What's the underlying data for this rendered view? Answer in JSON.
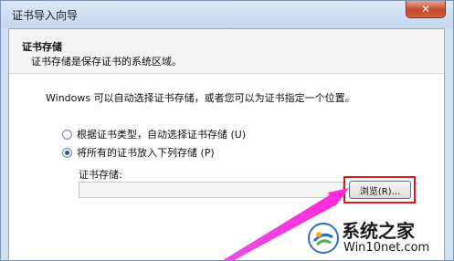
{
  "window": {
    "title": "证书导入向导",
    "close_glyph": "✕"
  },
  "header": {
    "title": "证书存储",
    "subtitle": "证书存储是保存证书的系统区域。"
  },
  "main": {
    "description": "Windows 可以自动选择证书存储，或者您可以为证书指定一个位置。",
    "options": [
      {
        "label": "根据证书类型，自动选择证书存储 (U)",
        "checked": false
      },
      {
        "label": "将所有的证书放入下列存储 (P)",
        "checked": true
      }
    ],
    "store_label": "证书存储:",
    "store_value": "",
    "browse_label": "浏览(R)..."
  },
  "watermark": {
    "brand": "系统之家",
    "url": "Win10net.com"
  },
  "colors": {
    "highlight": "#e01a1a",
    "arrow": "#e23be2",
    "window_frame": "#cfe0f1"
  }
}
